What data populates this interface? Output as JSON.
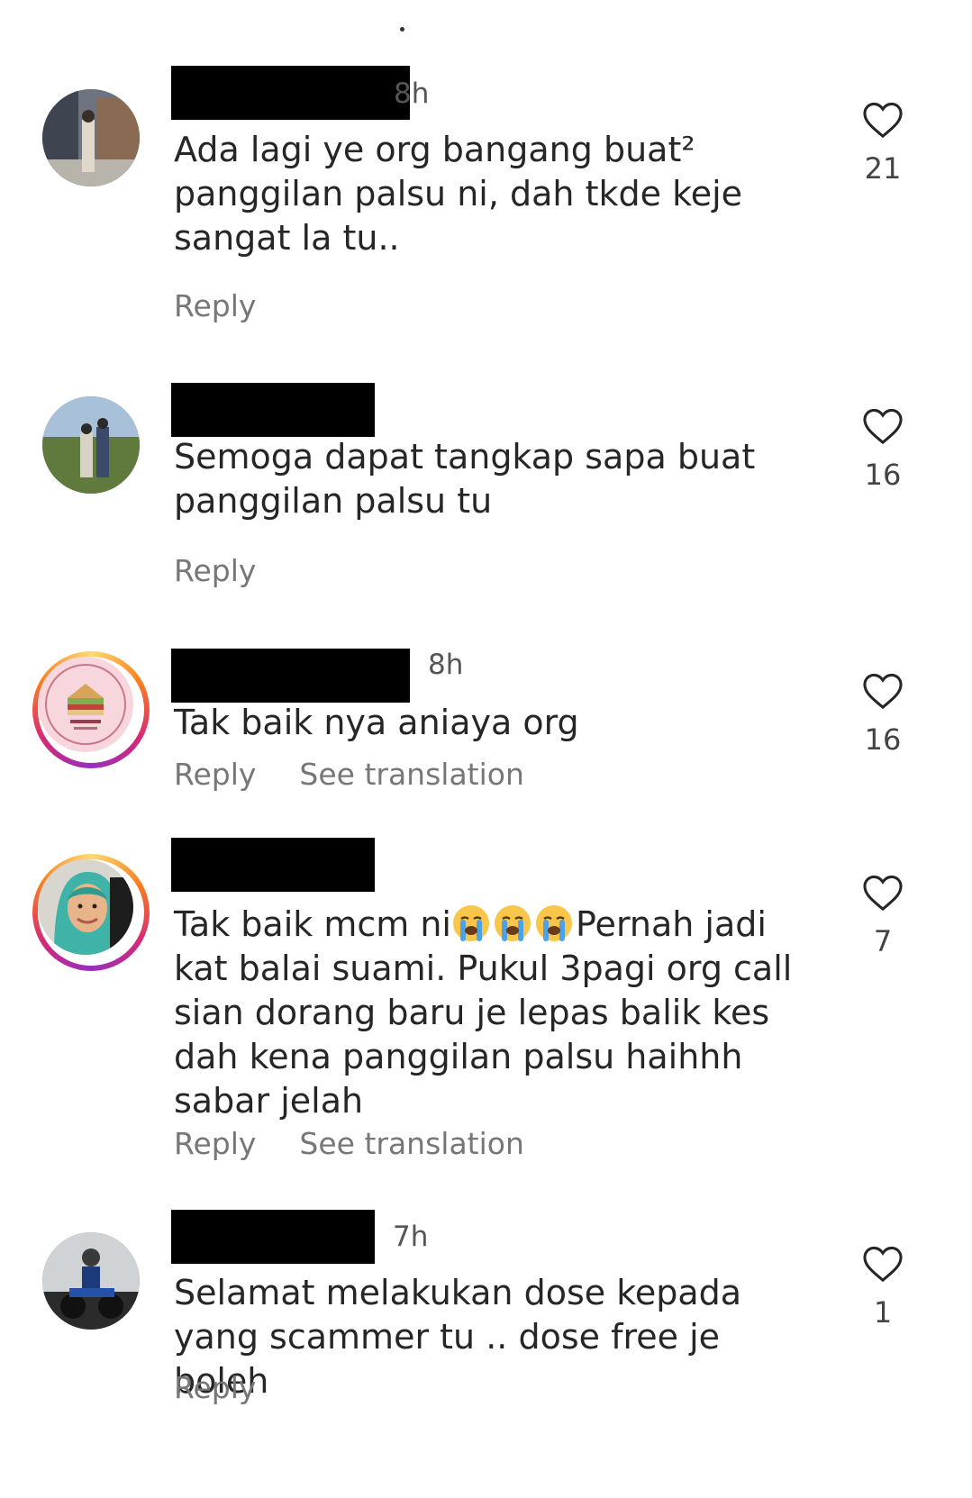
{
  "comments": [
    {
      "time": "8h",
      "text": "Ada lagi ye org bangang buat²\npanggilan palsu ni, dah tkde keje\nsangat la tu..",
      "likes": "21",
      "reply": "Reply"
    },
    {
      "time": "",
      "text": "Semoga dapat tangkap sapa buat\npanggilan palsu tu",
      "likes": "16",
      "reply": "Reply"
    },
    {
      "time": "8h",
      "text": "Tak baik nya aniaya org",
      "likes": "16",
      "reply": "Reply",
      "translate": "See translation"
    },
    {
      "time": "",
      "text_before_emoji": "Tak baik mcm ni",
      "emoji": [
        "loudly-crying-face",
        "loudly-crying-face",
        "loudly-crying-face"
      ],
      "text_after_emoji": "Pernah jadi\nkat balai suami. Pukul 3pagi org call\nsian dorang baru je lepas balik kes\ndah kena panggilan palsu haihhh\nsabar jelah",
      "likes": "7",
      "reply": "Reply",
      "translate": "See translation"
    },
    {
      "time": "7h",
      "text": "Selamat melakukan dose kepada\nyang scammer tu .. dose free je boleh",
      "likes": "1",
      "reply": "Reply"
    }
  ],
  "colors": {
    "text": "#262626",
    "muted": "#777777",
    "heart_stroke": "#262626",
    "story_ring": [
      "#feda75",
      "#fa7e1e",
      "#d62976",
      "#962fbf"
    ]
  }
}
